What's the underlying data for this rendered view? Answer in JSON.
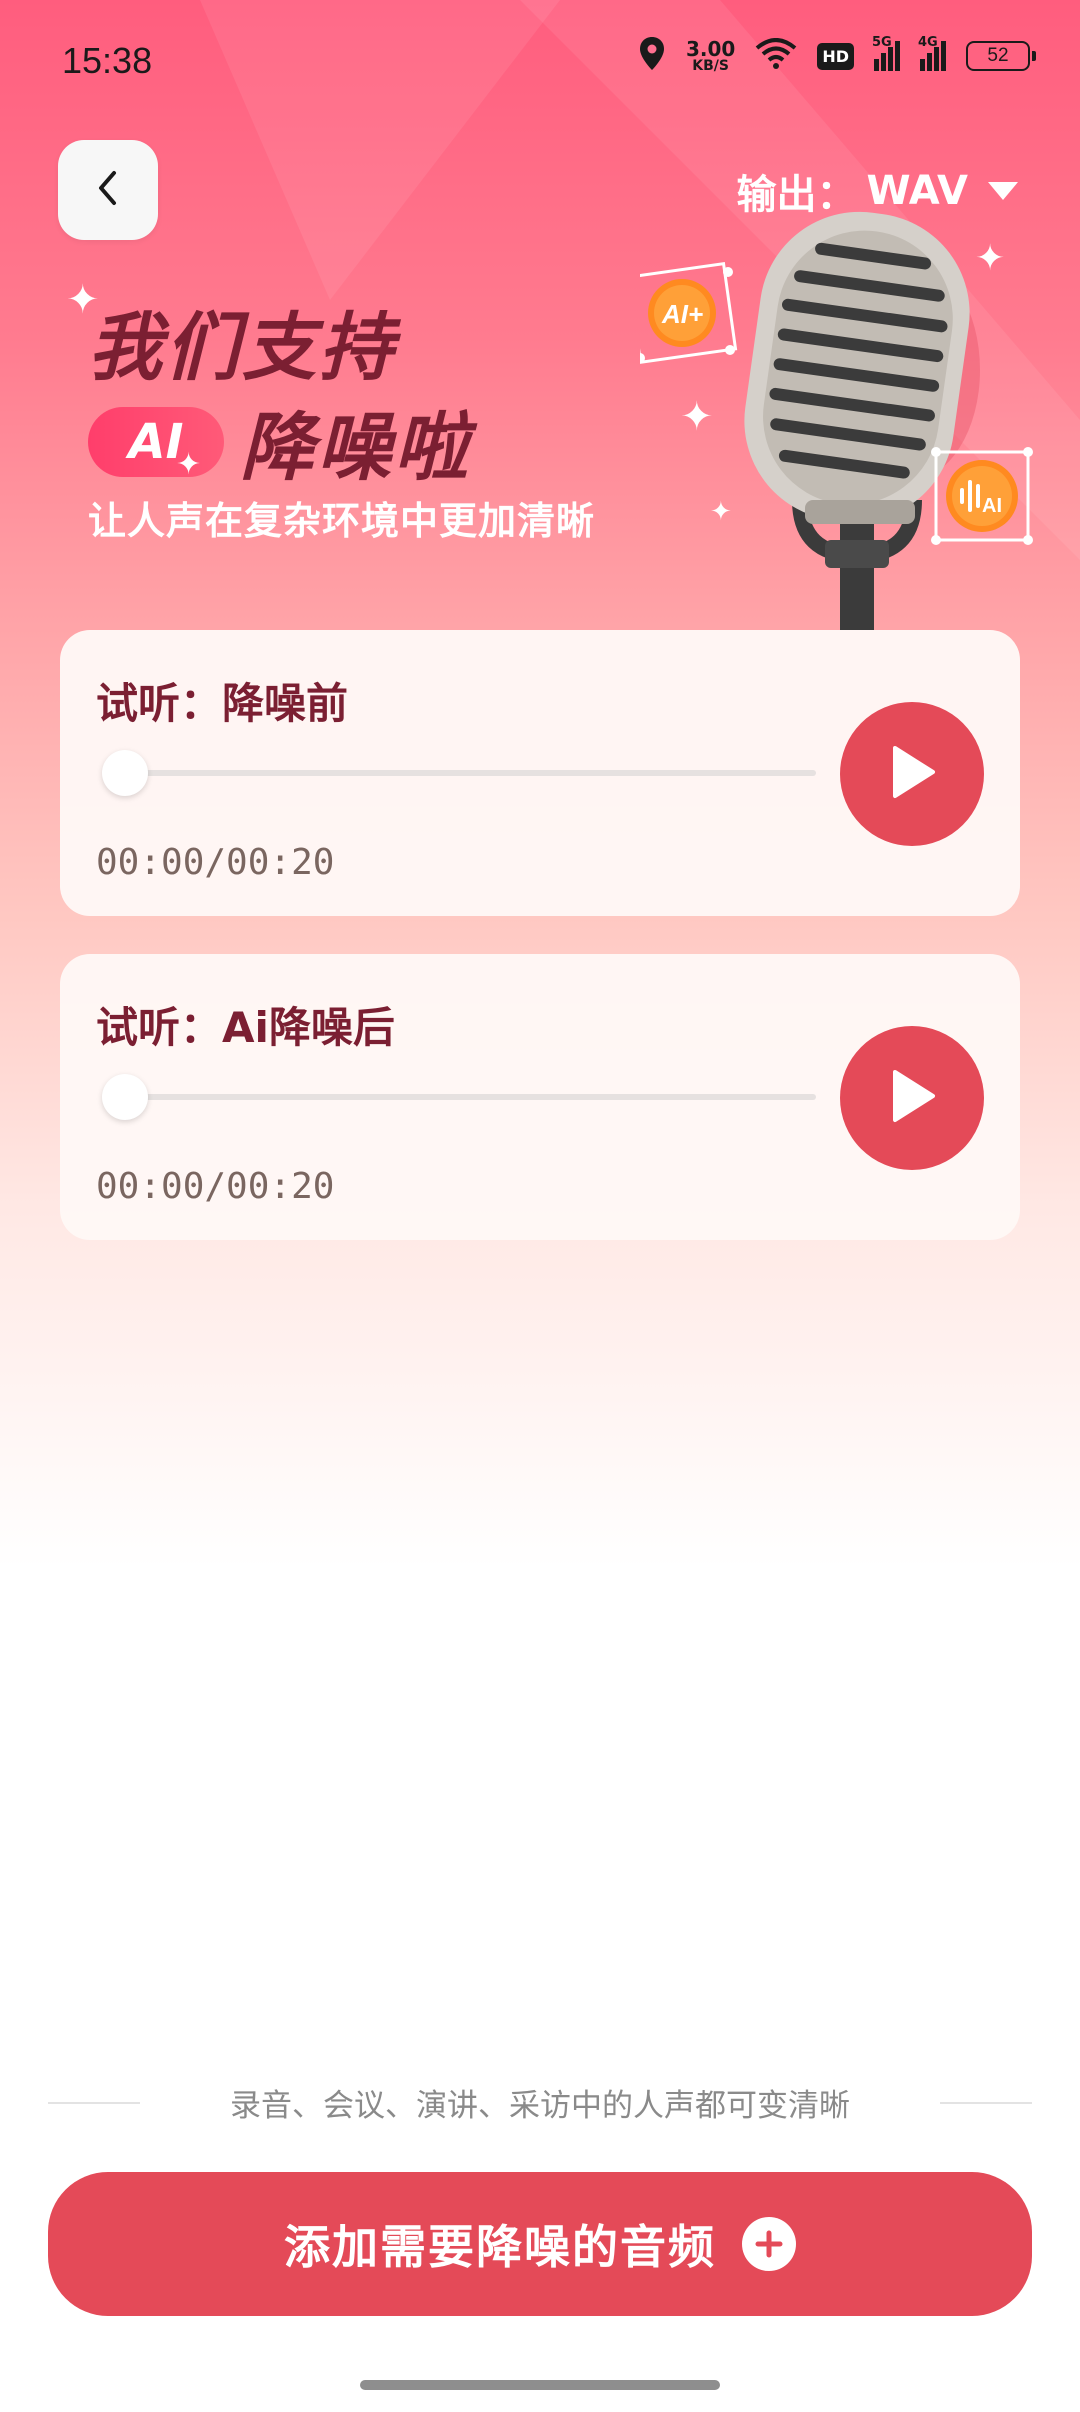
{
  "status_bar": {
    "time": "15:38",
    "net_speed_value": "3.00",
    "net_speed_unit": "KB/S",
    "hd_label": "HD",
    "sim1_label": "5G",
    "sim2_label": "4G",
    "battery": "52",
    "icons": [
      "location-icon",
      "wifi-icon",
      "signal-icon",
      "battery-icon"
    ]
  },
  "header": {
    "back_icon": "chevron-left-icon",
    "output_label": "输出：",
    "output_value": "WAV",
    "output_icon": "caret-down-icon"
  },
  "hero": {
    "line1": "我们支持",
    "ai_badge": "AI",
    "line2": "降噪啦",
    "subtitle": "让人声在复杂环境中更加清晰",
    "decorations": [
      "microphone-illustration",
      "ai-plus-badge-icon",
      "ai-audio-badge-icon",
      "sparkle-icon"
    ]
  },
  "cards": [
    {
      "title": "试听：降噪前",
      "progress": 0,
      "time": "00:00/00:20",
      "play_icon": "play-icon"
    },
    {
      "title": "试听：Ai降噪后",
      "progress": 0,
      "time": "00:00/00:20",
      "play_icon": "play-icon"
    }
  ],
  "footer": {
    "tip": "录音、会议、演讲、采访中的人声都可变清晰",
    "add_button_label": "添加需要降噪的音频",
    "add_icon": "plus-circle-icon"
  },
  "colors": {
    "accent": "#e44a58",
    "hero_text": "#7b1f32",
    "gradient_top": "#ff5d7e"
  }
}
